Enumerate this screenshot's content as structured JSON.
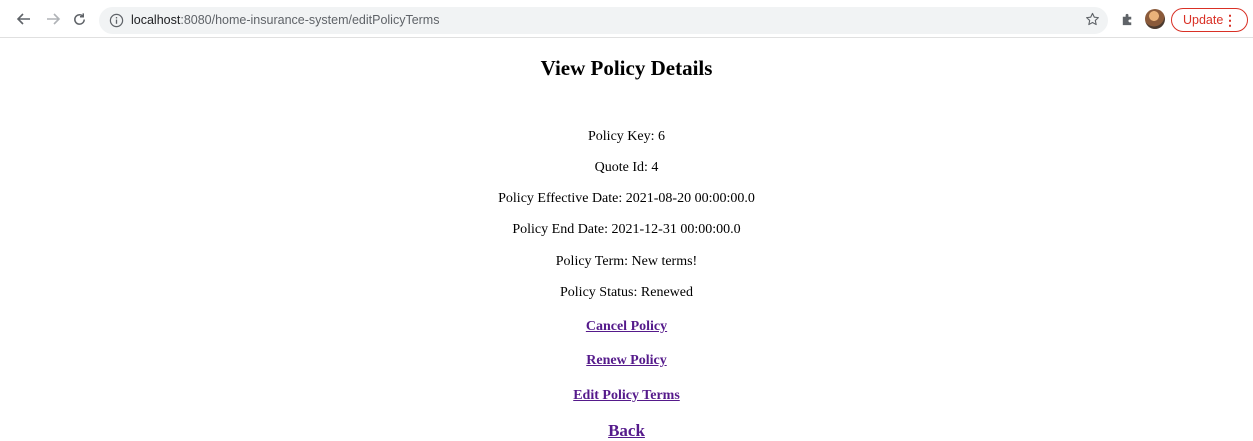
{
  "browser": {
    "url_host": "localhost",
    "url_path": ":8080/home-insurance-system/editPolicyTerms",
    "update_label": "Update",
    "update_menu": "⋮"
  },
  "page": {
    "title": "View Policy Details",
    "policy_key": "Policy Key: 6",
    "quote_id": "Quote Id: 4",
    "effective_date": "Policy Effective Date: 2021-08-20 00:00:00.0",
    "end_date": "Policy End Date: 2021-12-31 00:00:00.0",
    "policy_term": "Policy Term: New terms!",
    "policy_status": "Policy Status: Renewed"
  },
  "links": {
    "cancel": "Cancel Policy",
    "renew": "Renew Policy",
    "edit_terms": "Edit Policy Terms",
    "back": "Back"
  },
  "colors": {
    "link": "#551a8b",
    "update_accent": "#d93025"
  },
  "icons": [
    "back-arrow-icon",
    "forward-arrow-icon",
    "reload-icon",
    "info-icon",
    "star-icon",
    "puzzle-extension-icon"
  ]
}
